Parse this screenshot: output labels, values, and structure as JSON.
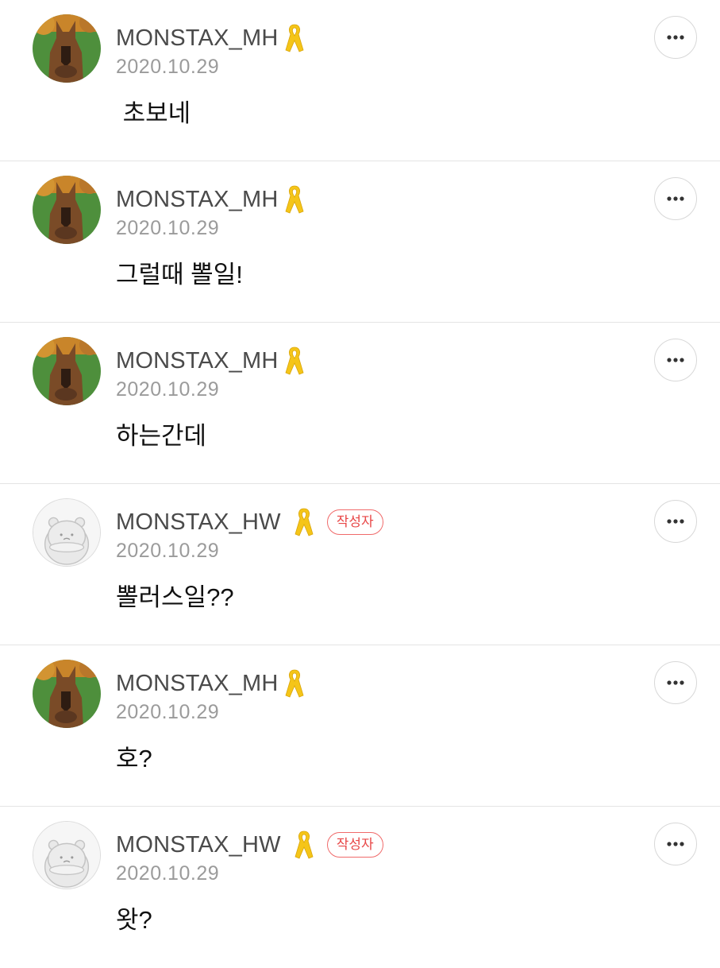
{
  "comments": [
    {
      "author": "MONSTAX_MH",
      "avatar": "dog-photo-avatar",
      "date": "2020.10.29",
      "text": " 초보네",
      "badge": null
    },
    {
      "author": "MONSTAX_MH",
      "avatar": "dog-photo-avatar",
      "date": "2020.10.29",
      "text": "그럴때 뽈일!",
      "badge": null
    },
    {
      "author": "MONSTAX_MH",
      "avatar": "dog-photo-avatar",
      "date": "2020.10.29",
      "text": "하는간데",
      "badge": null
    },
    {
      "author": "MONSTAX_HW",
      "avatar": "default-hamster-avatar",
      "date": "2020.10.29",
      "text": "뽈러스일??",
      "badge": "작성자"
    },
    {
      "author": "MONSTAX_MH",
      "avatar": "dog-photo-avatar",
      "date": "2020.10.29",
      "text": "호?",
      "badge": null
    },
    {
      "author": "MONSTAX_HW",
      "avatar": "default-hamster-avatar",
      "date": "2020.10.29",
      "text": "왓?",
      "badge": "작성자"
    }
  ],
  "icons": {
    "ribbon": "yellow-ribbon-icon",
    "more": "more-options-icon"
  },
  "colors": {
    "ribbon": "#f5c518",
    "badge": "#e84747",
    "divider": "#e4e4e4",
    "date": "#9b9b9b"
  }
}
